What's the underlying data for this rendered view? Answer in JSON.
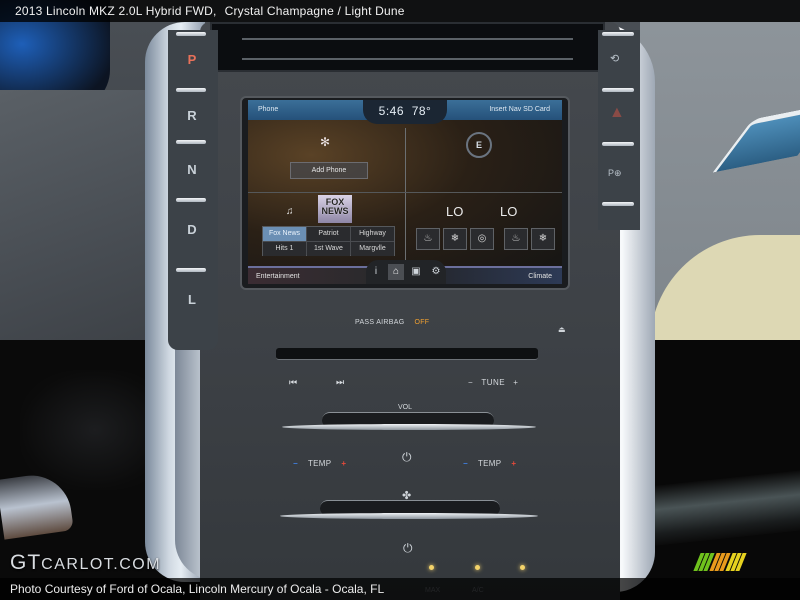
{
  "caption": {
    "title": "2013 Lincoln MKZ 2.0L Hybrid FWD,",
    "colors": "Crystal Champagne / Light Dune",
    "credit": "Photo Courtesy of Ford of Ocala, Lincoln Mercury of Ocala - Ocala, FL"
  },
  "watermark": {
    "brand_big": "GT",
    "brand_small": "CARLOT.COM"
  },
  "logo": {
    "stripe_colors": [
      "#6fc21d",
      "#e89a1c",
      "#e6d21f"
    ],
    "stripes_per_group": 3
  },
  "gear_selector": {
    "gears": [
      {
        "label": "P",
        "color": "#e8715a",
        "active": true
      },
      {
        "label": "R",
        "color": "#c9d1d8",
        "active": false
      },
      {
        "label": "N",
        "color": "#c9d1d8",
        "active": false
      },
      {
        "label": "D",
        "color": "#c9d1d8",
        "active": false
      },
      {
        "label": "L",
        "color": "#c9d1d8",
        "active": false
      }
    ]
  },
  "right_buttons": {
    "items": [
      {
        "icon": "steering-assist-icon",
        "glyph": "⟲"
      },
      {
        "icon": "hazard-icon",
        "glyph": "▲"
      },
      {
        "icon": "park-assist-icon",
        "glyph": "P⊕"
      }
    ]
  },
  "screen": {
    "top_left": "Phone",
    "clock": "5:46",
    "temperature": "78°",
    "top_right": "Insert Nav SD Card",
    "add_phone": "Add Phone",
    "compass_letter": "E",
    "radio_logo": {
      "line1": "FOX",
      "line2": "NEWS"
    },
    "presets": [
      "Fox News",
      "Patriot",
      "Highway",
      "Hits 1",
      "1st Wave",
      "Margvlle"
    ],
    "active_preset": "Fox News",
    "climate_left": "LO",
    "climate_right": "LO",
    "seat_buttons": [
      {
        "icon": "heated-seat-icon",
        "glyph": "♨"
      },
      {
        "icon": "cooled-seat-icon",
        "glyph": "❄"
      },
      {
        "icon": "heated-steering-icon",
        "glyph": "◎"
      },
      {
        "icon": "heated-seat-icon",
        "glyph": "♨"
      },
      {
        "icon": "cooled-seat-icon",
        "glyph": "❄"
      }
    ],
    "bottom_left": "Entertainment",
    "bottom_right": "Climate",
    "nav_tabs": [
      {
        "icon": "info-icon",
        "glyph": "i",
        "active": false
      },
      {
        "icon": "home-icon",
        "glyph": "⌂",
        "active": true
      },
      {
        "icon": "phone-contact-icon",
        "glyph": "▣",
        "active": false
      },
      {
        "icon": "settings-icon",
        "glyph": "⚙",
        "active": false
      }
    ]
  },
  "console": {
    "airbag_label": "PASS AIRBAG",
    "airbag_status": "OFF",
    "eject_glyph": "⏏",
    "prev_glyph": "⏮",
    "next_glyph": "⏭",
    "tune_minus": "−",
    "tune_label": "TUNE",
    "tune_plus": "+",
    "vol_label": "VOL",
    "temp_label": "TEMP",
    "temp_minus": "−",
    "temp_plus": "+",
    "power_glyph": "⏻",
    "fan_glyph": "✤",
    "faded_labels": [
      "MAX",
      "A/C"
    ]
  }
}
